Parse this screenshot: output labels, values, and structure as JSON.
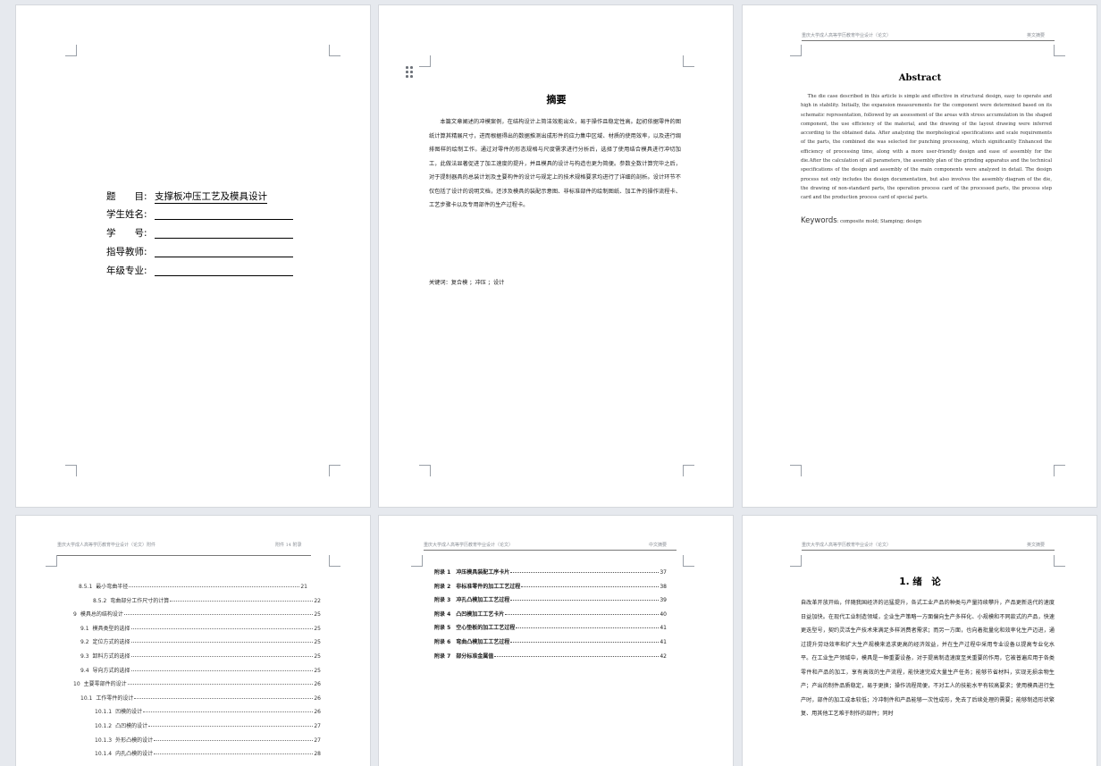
{
  "pages": {
    "cover": {
      "title_label": "题　　目:",
      "title_value": "支撑板冲压工艺及模具设计",
      "name_label": "学生姓名:",
      "id_label": "学　　号:",
      "advisor_label": "指导教师:",
      "major_label": "年级专业:"
    },
    "abstract_cn": {
      "title": "摘要",
      "body": "本篇文章阐述的冲模案例，在结构设计上简洁效能出众，易于操作且稳定性高。起初依据零件的图纸计算其精展尺寸，进而根据得出的数据推测出成形件的应力集中区域、材质的使用效率，以及进行绸排图样的绘制工作。通过对零件的形态规格与尺度需求进行分析后，选择了使用结合模具进行冲切加工，此做法显著促进了加工速度的提升，并且模具的设计与构造也更为简便。参数全数计算完毕之后，对于提制器具的总装计划及主要构件的设计与规定上的技术规格要求均进行了详细的剖析。设计环节不仅包括了设计的说明文档，还涉及模具的装配示意图、非标准部件的绘制图纸、加工件的操作流程卡、工艺步骤卡以及专用部件的生产过程卡。",
      "keywords": "关键词：复合模 ；冲压 ；设计"
    },
    "abstract_en": {
      "header_left": "重庆大学成人高等学历教育毕业设计（论文）",
      "header_right": "英文摘要",
      "title": "Abstract",
      "body": "The die case described in this article is simple and effective in structural design, easy to operate and high in stability. Initially, the expansion measurements for the component were determined based on its schematic representation, followed by an assessment of the areas with stress accumulation in the shaped component, the use efficiency of the material, and the drawing of the layout drawing were inferred according to the obtained data. After analyzing the morphological specifications and scale requirements of the parts, the combined die was selected for punching processing, which significantly Enhanced the efficiency of processing time, along with a more user-friendly design and ease of assembly for the die.After the calculation of all parameters, the assembly plan of the grinding apparatus and the technical specifications of the design and assembly of the main components were analyzed in detail. The design process not only includes the design documentation, but also involves the assembly diagram of the die, the drawing of non-standard parts, the operation process card of the processed parts, the process step card and the production process card of special parts.",
      "keywords_label": "Keywords",
      "keywords": ": composite mold; Stamping; design"
    },
    "toc": {
      "header_left": "重庆大学成人高等学历教育毕业设计（论文）附件",
      "header_right": "附件 14 附录",
      "rows": [
        {
          "num": "8.5.1",
          "label": "最小弯曲半径",
          "page": "21"
        },
        {
          "num": "8.5.2",
          "label": "弯曲部分工作尺寸的计算",
          "page": "22"
        },
        {
          "num": "9",
          "label": "模具总的结构设计",
          "page": "25"
        },
        {
          "num": "9.1",
          "label": "模具类型的选择",
          "page": "25"
        },
        {
          "num": "9.2",
          "label": "定位方式的选择",
          "page": "25"
        },
        {
          "num": "9.3",
          "label": "卸料方式的选择",
          "page": "25"
        },
        {
          "num": "9.4",
          "label": "导向方式的选择",
          "page": "25"
        },
        {
          "num": "10",
          "label": "主要零部件的设计",
          "page": "26"
        },
        {
          "num": "10.1",
          "label": "工作零件的设计",
          "page": "26"
        },
        {
          "num": "10.1.1",
          "label": "凹模的设计",
          "page": "26"
        },
        {
          "num": "10.1.2",
          "label": "凸凹模的设计",
          "page": "27"
        },
        {
          "num": "10.1.3",
          "label": "外形凸模的设计",
          "page": "27"
        },
        {
          "num": "10.1.4",
          "label": "内孔凸模的设计",
          "page": "28"
        }
      ]
    },
    "attachments": {
      "header_left": "重庆大学成人高等学历教育毕业设计（论文）",
      "header_right": "中文摘要",
      "rows": [
        {
          "label": "附录 1　冲压模具装配工序卡片",
          "page": "37"
        },
        {
          "label": "附录 2　非标准零件的加工工艺过程",
          "page": "38"
        },
        {
          "label": "附录 3　冲孔凸模加工工艺过程",
          "page": "39"
        },
        {
          "label": "附录 4　凸凹模加工工艺卡片",
          "page": "40"
        },
        {
          "label": "附录 5　空心垫板的加工工艺过程",
          "page": "41"
        },
        {
          "label": "附录 6　弯曲凸模加工工艺过程",
          "page": "41"
        },
        {
          "label": "附录 7　部分标准金属值",
          "page": "42"
        }
      ]
    },
    "intro": {
      "header_left": "重庆大学成人高等学历教育毕业设计（论文）",
      "header_right": "英文摘要",
      "title": "1.  绪　论",
      "body": "自改革开放开始，伴随我国经济的迅猛提升，各式工业产品的种类与产量持续攀升，产品更新迭代的速度日益加快。在现代工业制造领域，企业生产策略一方面偏向生产多样化、小规模和不同款式的产品，快速更迭型号，契约灵活生产技术来满足多样消费者需求；而另一方面，也向着批量化和效率化生产迈进，通过提升劳动效率和扩大生产规模来追求更高的经济效益，并在生产过程中采用专业设备以提高专业化水平。在工业生产领域中，模具是一种重要设备，对于提高制造速度至关重要的作用，它被普遍应用于各类零件和产品的加工，享有高效的生产流程，能快速完成大量生产任务；能够节省材料，实现无损余物生产；产出的制件品质稳定，易于更换；操作流程简便，不对工人的技能水平有较高要求；使用模具进行生产时，部件的加工成本较低；冷冲制件和产品能够一次性成形，免去了后续处理的需要；能够制造形状繁复、用其他工艺难于制作的部件；同时"
    }
  }
}
